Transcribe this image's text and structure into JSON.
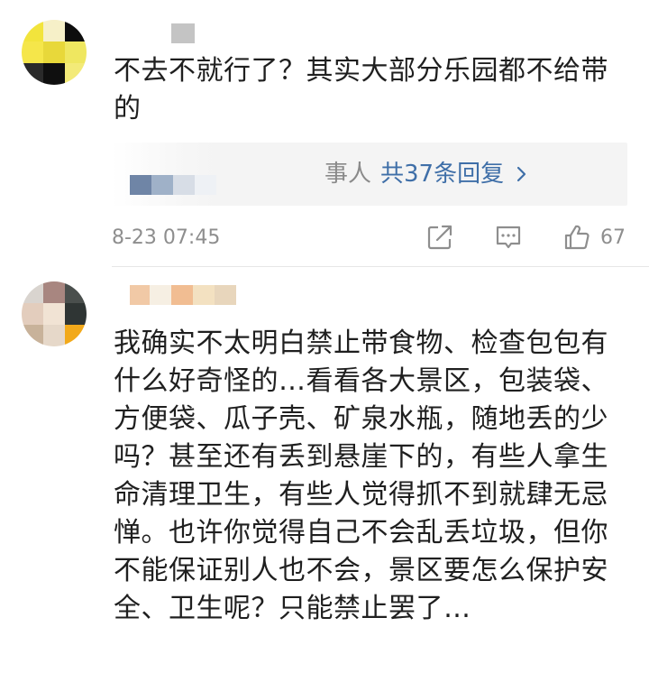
{
  "comments": [
    {
      "text": "不去不就行了？其实大部分乐园都不给带的",
      "time": "8-23 07:45",
      "replies": {
        "who_text": "事人",
        "link_text": "共37条回复"
      },
      "likes": "67"
    },
    {
      "text": "我确实不太明白禁止带食物、检查包包有什么好奇怪的…看看各大景区，包装袋、方便袋、瓜子壳、矿泉水瓶，随地丢的少吗？甚至还有丢到悬崖下的，有些人拿生命清理卫生，有些人觉得抓不到就肆无忌惮。也许你觉得自己不会乱丢垃圾，但你不能保证别人也不会，景区要怎么保护安全、卫生呢？只能禁止罢了…"
    }
  ],
  "colors": {
    "link": "#3f6fa8",
    "meta": "#8e8e8e",
    "reply_bg": "#f4f4f4",
    "divider": "#e6e6e6"
  },
  "icons": [
    "share-icon",
    "comment-icon",
    "like-icon",
    "chevron-right-icon"
  ]
}
